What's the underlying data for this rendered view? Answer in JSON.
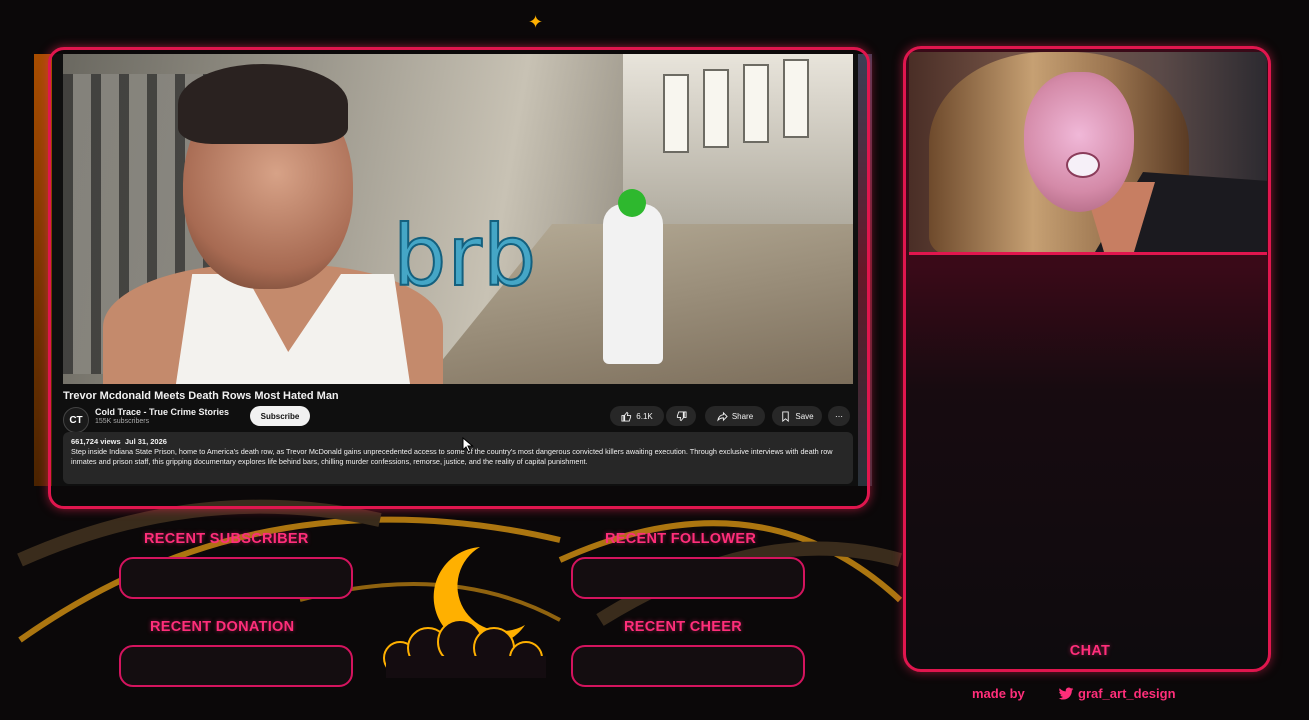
{
  "video": {
    "overlay_text": "brb",
    "title": "Trevor Mcdonald Meets Death Rows Most Hated Man",
    "channel_initials": "CT",
    "channel_name": "Cold Trace - True Crime Stories",
    "channel_subscribers": "155K subscribers",
    "subscribe_label": "Subscribe",
    "like_count": "6.1K",
    "share_label": "Share",
    "save_label": "Save",
    "views": "661,724 views",
    "date": "Jul 31, 2026",
    "description": "Step inside Indiana State Prison, home to America's death row, as Trevor McDonald gains unprecedented access to some of the country's most dangerous convicted killers awaiting execution. Through exclusive interviews with death row inmates and prison staff, this gripping documentary explores life behind bars, chilling murder confessions, remorse, justice, and the reality of capital punishment."
  },
  "widgets": {
    "recent_subscriber": "RECENT SUBSCRIBER",
    "recent_follower": "RECENT FOLLOWER",
    "recent_donation": "RECENT DONATION",
    "recent_cheer": "RECENT CHEER"
  },
  "chat": {
    "label": "CHAT"
  },
  "credits": {
    "made_by": "made by",
    "handle": "graf_art_design"
  },
  "colors": {
    "accent": "#ff2e7a",
    "frame": "#e0164e",
    "moon": "#ffb000",
    "youtube_dark": "#0f0f0f"
  },
  "icons": [
    "like-icon",
    "dislike-icon",
    "share-icon",
    "save-icon",
    "more-icon",
    "twitter-icon",
    "moon-icon",
    "sparkle-icon",
    "cursor-icon"
  ]
}
